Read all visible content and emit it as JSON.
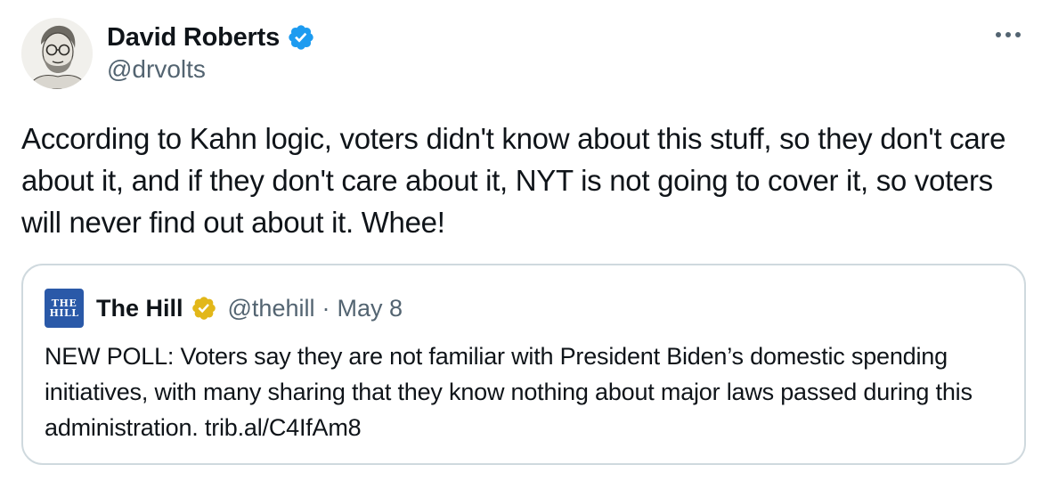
{
  "tweet": {
    "author": {
      "name": "David Roberts",
      "handle": "@drvolts",
      "verified_icon": "verified-badge-icon",
      "avatar_icon": "avatar-sketch-portrait"
    },
    "more_icon": "more-options-icon",
    "text": "According to Kahn logic, voters didn't know about this stuff, so they don't care about it, and if they don't care about it, NYT is not going to cover it, so voters will never find out about it. Whee!"
  },
  "quoted_tweet": {
    "logo_text_line1": "THE",
    "logo_text_line2": "HILL",
    "name": "The Hill",
    "badge_icon": "gold-verified-badge-icon",
    "handle": "@thehill",
    "separator": "·",
    "date": "May 8",
    "text": "NEW POLL: Voters say they are not familiar with President Biden’s domestic spending initiatives, with many sharing that they know nothing about major laws passed during this administration.",
    "link": "trib.al/C4IfAm8"
  },
  "colors": {
    "text_primary": "#0f1419",
    "text_secondary": "#536471",
    "verified_blue": "#1d9bf0",
    "verified_gold": "#e2b719",
    "card_border": "#cfd9de",
    "hill_blue": "#2a59a8"
  }
}
